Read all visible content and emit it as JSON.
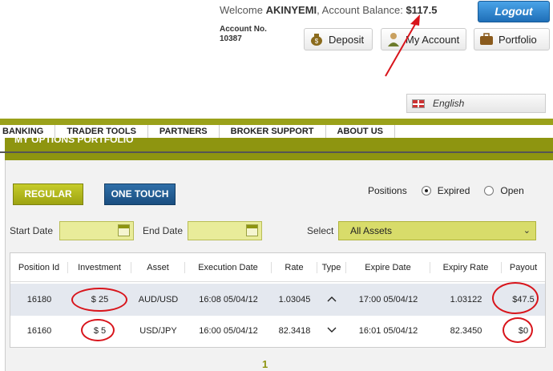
{
  "header": {
    "welcome_prefix": "Welcome",
    "username": "AKINYEMI",
    "balance_label": ", Account Balance:",
    "balance_value": "$117.5",
    "logout_label": "Logout",
    "account_label": "Account No.",
    "account_number": "10387",
    "deposit_label": "Deposit",
    "my_account_label": "My Account",
    "portfolio_label": "Portfolio",
    "language": "English"
  },
  "nav": [
    "BANKING",
    "TRADER TOOLS",
    "PARTNERS",
    "BROKER SUPPORT",
    "ABOUT US"
  ],
  "portfolio": {
    "title": "MY OPTIONS PORTFOLIO",
    "regular_label": "REGULAR",
    "one_touch_label": "ONE TOUCH",
    "positions_label": "Positions",
    "expired_label": "Expired",
    "open_label": "Open",
    "positions_selected": "Expired",
    "start_date_label": "Start Date",
    "end_date_label": "End Date",
    "select_label": "Select",
    "select_value": "All Assets"
  },
  "table": {
    "headers": [
      "Position Id",
      "Investment",
      "Asset",
      "Execution Date",
      "Rate",
      "Type",
      "Expire Date",
      "Expiry Rate",
      "Payout"
    ],
    "rows": [
      {
        "id": "16180",
        "investment": "$ 25",
        "asset": "AUD/USD",
        "execution": "16:08 05/04/12",
        "rate": "1.03045",
        "type": "up",
        "expire": "17:00 05/04/12",
        "expiry_rate": "1.03122",
        "payout": "$47.5"
      },
      {
        "id": "16160",
        "investment": "$ 5",
        "asset": "USD/JPY",
        "execution": "16:00 05/04/12",
        "rate": "82.3418",
        "type": "down",
        "expire": "16:01 05/04/12",
        "expiry_rate": "82.3450",
        "payout": "$0"
      }
    ]
  },
  "pager": {
    "current": "1"
  },
  "colors": {
    "olive": "#8e9510",
    "annotation_red": "#d8141b",
    "logout_blue": "#1f6fb8"
  }
}
